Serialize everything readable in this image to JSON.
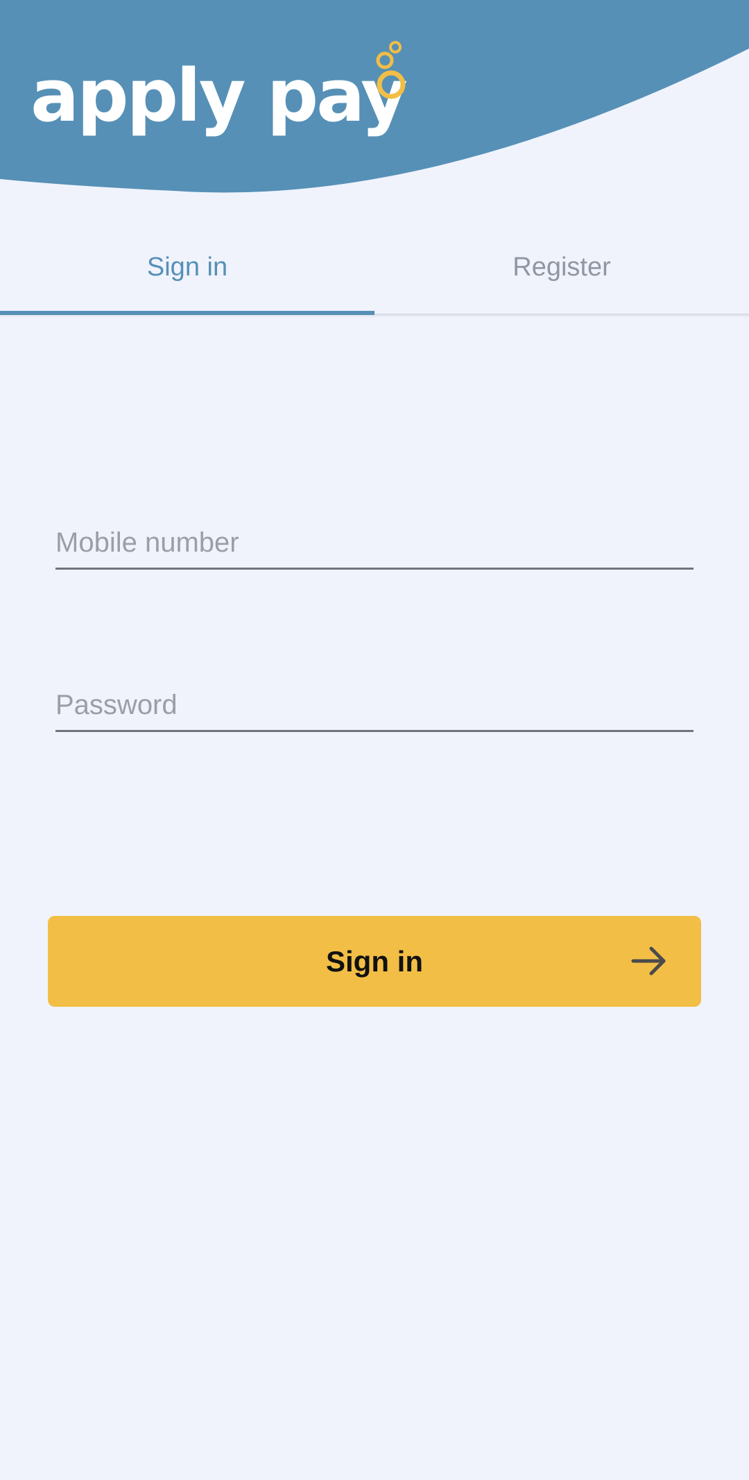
{
  "header": {
    "brand_text": "apply pay",
    "colors": {
      "header_blue": "#5690b6",
      "accent_yellow": "#f2be46",
      "background": "#f0f3fc"
    }
  },
  "tabs": {
    "signin_label": "Sign in",
    "register_label": "Register",
    "active": "signin"
  },
  "form": {
    "mobile_placeholder": "Mobile number",
    "mobile_value": "",
    "password_placeholder": "Password",
    "password_value": ""
  },
  "actions": {
    "signin_label": "Sign in",
    "signin_icon": "arrow-right-icon"
  }
}
